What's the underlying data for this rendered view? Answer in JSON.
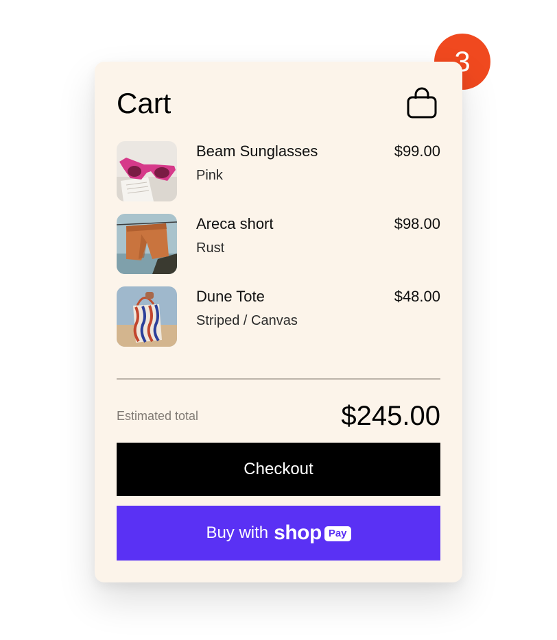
{
  "cart": {
    "title": "Cart",
    "count": "3",
    "icon": "shopping-bag-icon",
    "items": [
      {
        "name": "Beam Sunglasses",
        "variant": "Pink",
        "price": "$99.00"
      },
      {
        "name": "Areca short",
        "variant": "Rust",
        "price": "$98.00"
      },
      {
        "name": "Dune Tote",
        "variant": "Striped / Canvas",
        "price": "$48.00"
      }
    ],
    "total_label": "Estimated total",
    "total_value": "$245.00",
    "checkout_label": "Checkout",
    "shop_pay": {
      "prefix": "Buy with",
      "brand": "shop",
      "pill": "Pay"
    }
  },
  "colors": {
    "badge": "#f0491f",
    "card_background": "#fcf4ea",
    "checkout_button": "#000000",
    "shop_pay_button": "#5a31f4"
  }
}
